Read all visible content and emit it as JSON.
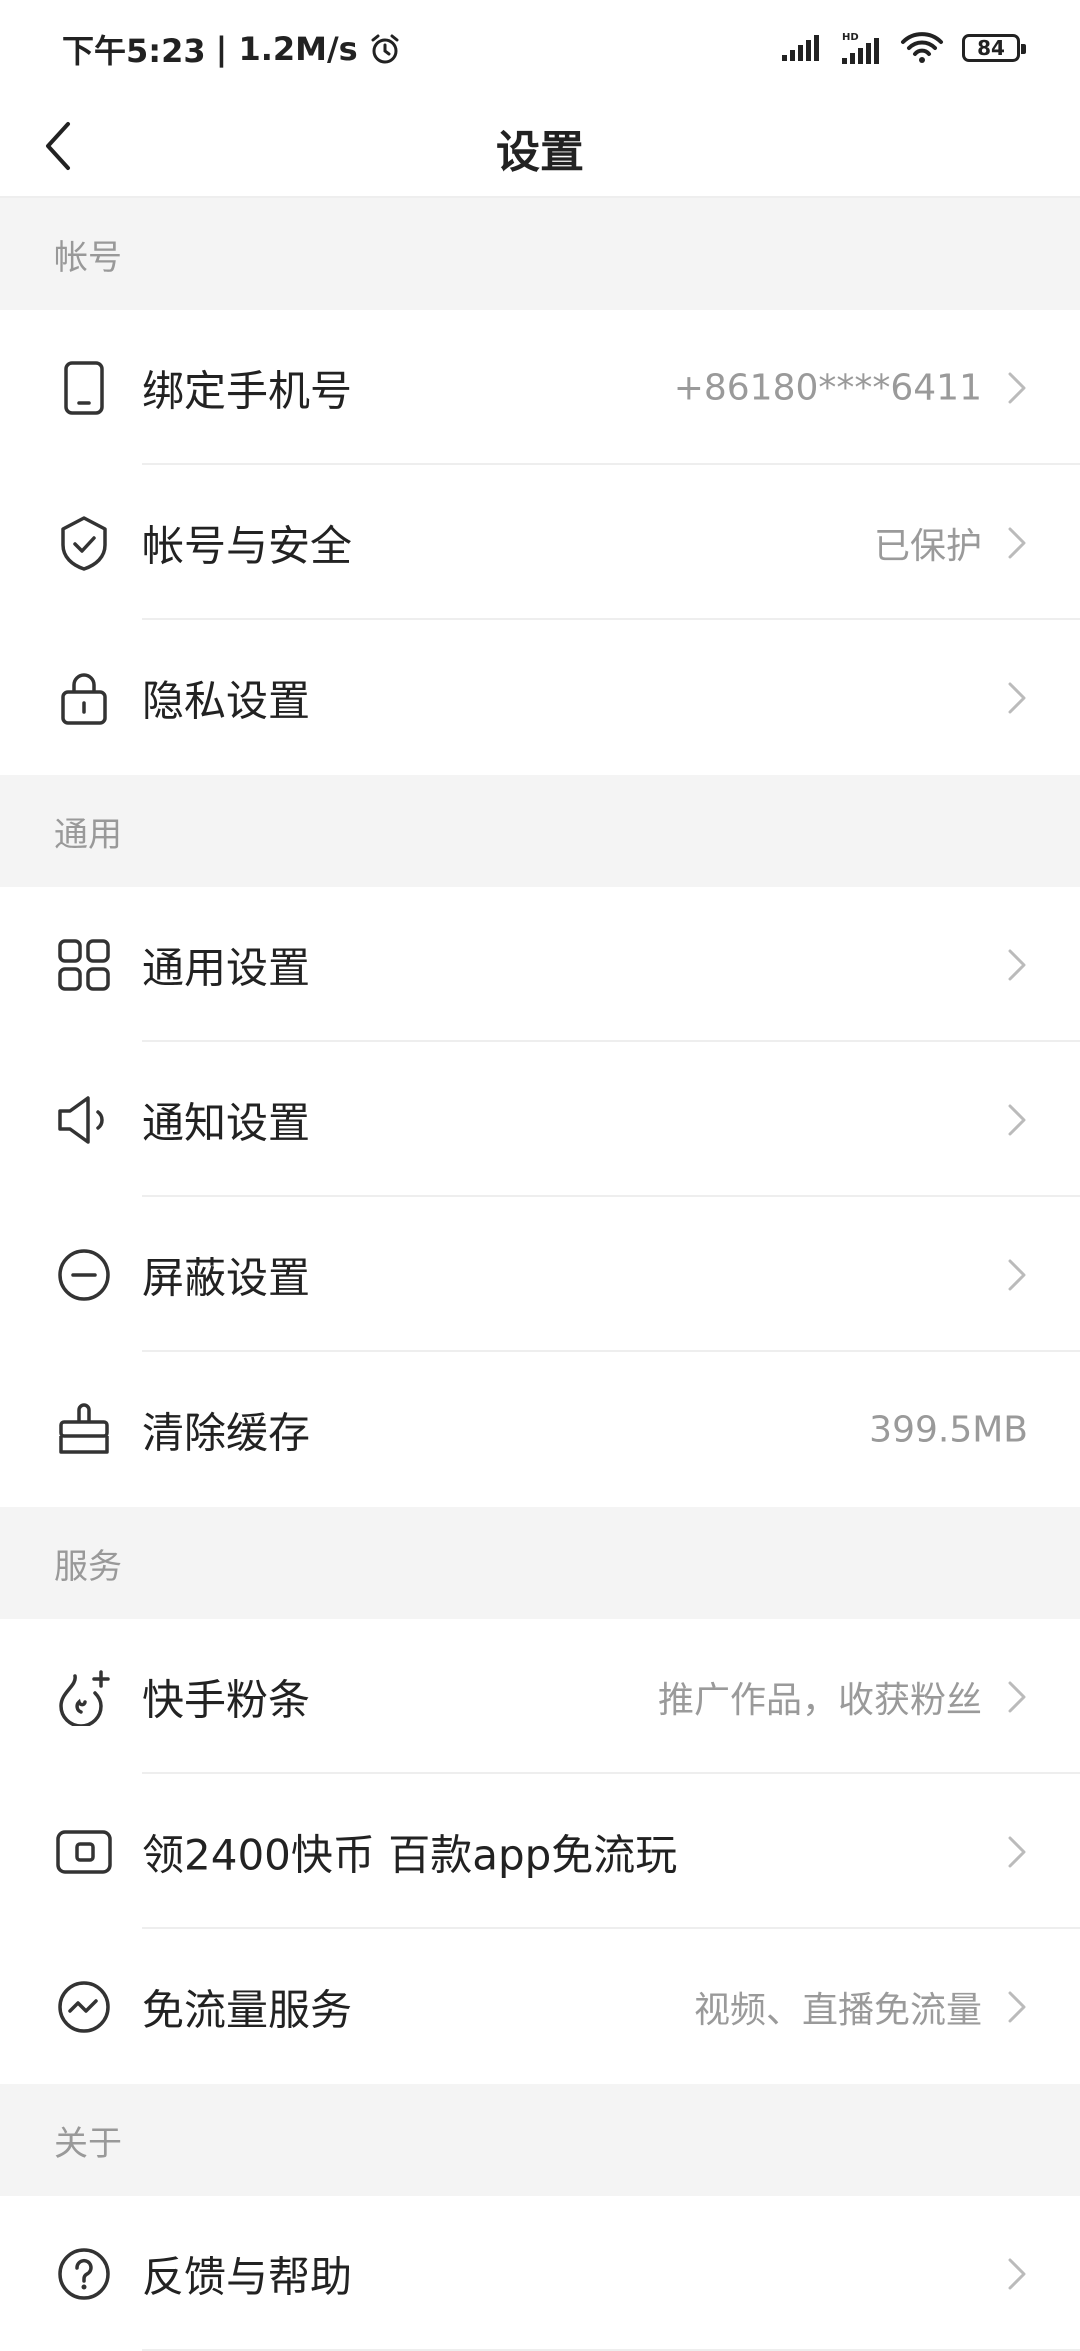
{
  "status_bar": {
    "time": "下午5:23",
    "speed": "| 1.2M/s",
    "battery": "84",
    "icons": [
      "alarm-icon",
      "signal-icon",
      "hd-signal-icon",
      "wifi-icon",
      "battery-icon"
    ]
  },
  "header": {
    "title": "设置",
    "back_icon": "back-arrow-icon"
  },
  "sections": {
    "account": "帐号",
    "general": "通用",
    "service": "服务",
    "about": "关于"
  },
  "items": {
    "bind_phone": {
      "label": "绑定手机号",
      "value": "+86180****6411",
      "icon": "phone-icon"
    },
    "account_security": {
      "label": "帐号与安全",
      "value": "已保护",
      "icon": "shield-icon"
    },
    "privacy": {
      "label": "隐私设置",
      "icon": "lock-icon"
    },
    "general_settings": {
      "label": "通用设置",
      "icon": "grid-icon"
    },
    "notification": {
      "label": "通知设置",
      "icon": "speaker-icon"
    },
    "block": {
      "label": "屏蔽设置",
      "icon": "minus-circle-icon"
    },
    "clear_cache": {
      "label": "清除缓存",
      "value": "399.5MB",
      "icon": "brush-icon"
    },
    "fans": {
      "label": "快手粉条",
      "value": "推广作品，收获粉丝",
      "icon": "flame-plus-icon"
    },
    "coins": {
      "label": "领2400快币 百款app免流玩",
      "icon": "card-icon"
    },
    "free_data": {
      "label": "免流量服务",
      "value": "视频、直播免流量",
      "icon": "wave-circle-icon"
    },
    "feedback": {
      "label": "反馈与帮助",
      "icon": "question-icon"
    }
  }
}
